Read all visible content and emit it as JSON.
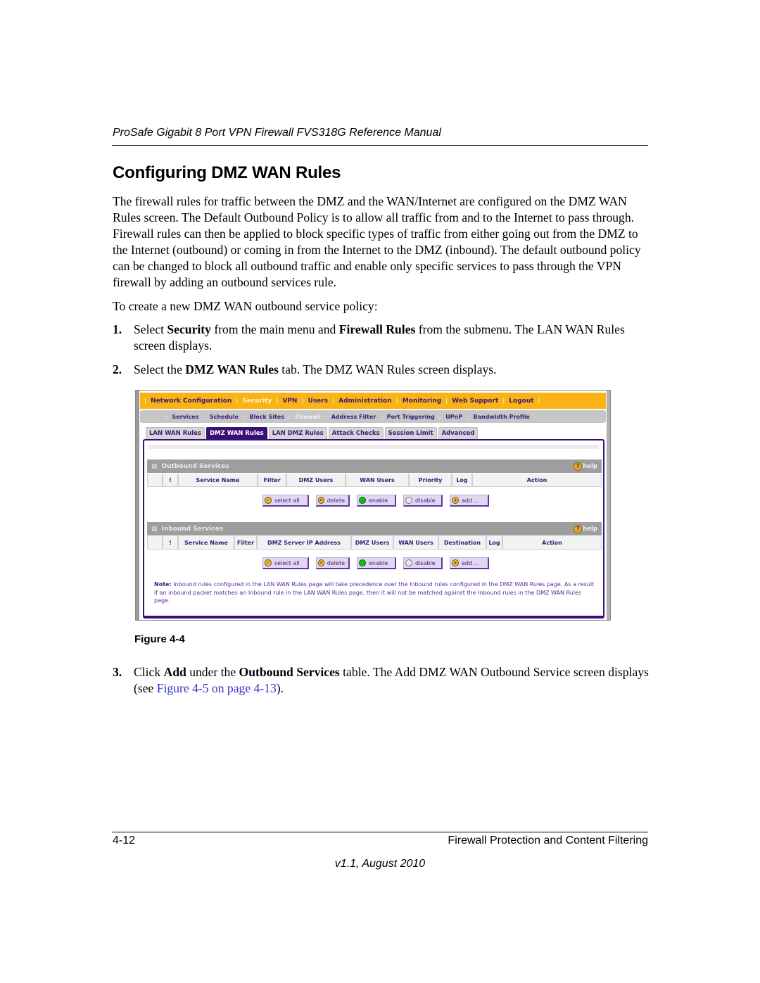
{
  "header": {
    "manual_title": "ProSafe Gigabit 8 Port VPN Firewall FVS318G Reference Manual"
  },
  "section": {
    "title": "Configuring DMZ WAN Rules",
    "intro": "The firewall rules for traffic between the DMZ and the WAN/Internet are configured on the DMZ WAN Rules screen. The Default Outbound Policy is to allow all traffic from and to the Internet to pass through. Firewall rules can then be applied to block specific types of traffic from either going out from the DMZ to the Internet (outbound) or coming in from the Internet to the DMZ (inbound). The default outbound policy can be changed to block all outbound traffic and enable only specific services to pass through the VPN firewall by adding an outbound services rule.",
    "lead_in": "To create a new DMZ WAN outbound service policy:",
    "steps": [
      {
        "num": "1.",
        "parts": [
          "Select ",
          "Security",
          " from the main menu and ",
          "Firewall Rules",
          " from the submenu. The LAN WAN Rules screen displays."
        ]
      },
      {
        "num": "2.",
        "parts": [
          "Select the ",
          "DMZ WAN Rules",
          " tab. The DMZ WAN Rules screen displays."
        ]
      },
      {
        "num": "3.",
        "parts": [
          "Click ",
          "Add",
          " under the ",
          "Outbound Services",
          " table. The Add DMZ WAN Outbound Service screen displays (see ",
          "Figure 4-5 on page 4-13",
          ")."
        ]
      }
    ],
    "figure_label": "Figure 4-4"
  },
  "ui": {
    "top_menu": [
      "Network Configuration",
      "Security",
      "VPN",
      "Users",
      "Administration",
      "Monitoring",
      "Web Support",
      "Logout"
    ],
    "top_menu_active": "Security",
    "sub_menu": [
      "Services",
      "Schedule",
      "Block Sites",
      "Firewall",
      "Address Filter",
      "Port Triggering",
      "UPnP",
      "Bandwidth Profile"
    ],
    "sub_menu_active": "Firewall",
    "tabs": [
      "LAN WAN Rules",
      "DMZ WAN Rules",
      "LAN DMZ Rules",
      "Attack Checks",
      "Session Limit",
      "Advanced"
    ],
    "tab_active": "DMZ WAN Rules",
    "help_label": "help",
    "outbound": {
      "title": "Outbound Services",
      "columns": [
        "",
        "!",
        "Service Name",
        "Filter",
        "DMZ Users",
        "WAN Users",
        "Priority",
        "Log",
        "Action"
      ]
    },
    "inbound": {
      "title": "Inbound Services",
      "columns": [
        "",
        "!",
        "Service Name",
        "Filter",
        "DMZ Server IP Address",
        "DMZ Users",
        "WAN Users",
        "Destination",
        "Log",
        "Action"
      ]
    },
    "buttons": {
      "select_all": "select all",
      "delete": "delete",
      "enable": "enable",
      "disable": "disable",
      "add": "add ..."
    },
    "note_label": "Note:",
    "note_text": "Inbound rules configured in the LAN WAN Rules page will take precedence over the Inbound rules configured in the DMZ WAN Rules page. As a result if an inbound packet matches an Inbound rule in the LAN WAN Rules page, then it will not be matched against the Inbound rules in the DMZ WAN Rules page."
  },
  "footer": {
    "page_number": "4-12",
    "chapter": "Firewall Protection and Content Filtering",
    "version": "v1.1, August 2010"
  },
  "colors": {
    "top_menu_bg": "#fbb214",
    "menu_text": "#3a1d7a",
    "active_tab_bg": "#3a1078",
    "link": "#3333cc"
  }
}
